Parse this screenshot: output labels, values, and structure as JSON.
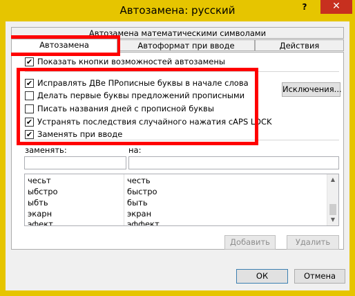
{
  "window": {
    "title": "Автозамена: русский",
    "help_label": "?",
    "close_label": "✕"
  },
  "tabs": {
    "math": "Автозамена математическими символами",
    "autocorrect": "Автозамена",
    "autoformat": "Автоформат при вводе",
    "actions": "Действия"
  },
  "options": {
    "show_buttons": {
      "label": "Показать кнопки возможностей автозамены",
      "checked": true
    },
    "two_caps": {
      "label": "Исправлять ДВе ПРописные буквы в начале слова",
      "checked": true
    },
    "sentence_caps": {
      "label": "Делать первые буквы предложений прописными",
      "checked": false
    },
    "day_names": {
      "label": "Писать названия дней с прописной буквы",
      "checked": false
    },
    "caps_lock": {
      "label": "Устранять последствия случайного нажатия cAPS LOCK",
      "checked": true
    },
    "replace_typing": {
      "label": "Заменять при вводе",
      "checked": true
    }
  },
  "exceptions_label": "Исключения...",
  "replace_label": "заменять:",
  "with_label": "на:",
  "entries": [
    {
      "from": "чесьт",
      "to": "честь"
    },
    {
      "from": "ыбстро",
      "to": "быстро"
    },
    {
      "from": "ыбть",
      "to": "быть"
    },
    {
      "from": "экарн",
      "to": "экран"
    },
    {
      "from": "эфект",
      "to": "эффект"
    }
  ],
  "add_label": "Добавить",
  "delete_label": "Удалить",
  "ok_label": "ОК",
  "cancel_label": "Отмена",
  "check_mark": "✔",
  "scroll_up": "▲",
  "scroll_down": "▼",
  "colors": {
    "frame": "#e6c500",
    "close": "#c7301f",
    "highlight": "#ff0000"
  }
}
